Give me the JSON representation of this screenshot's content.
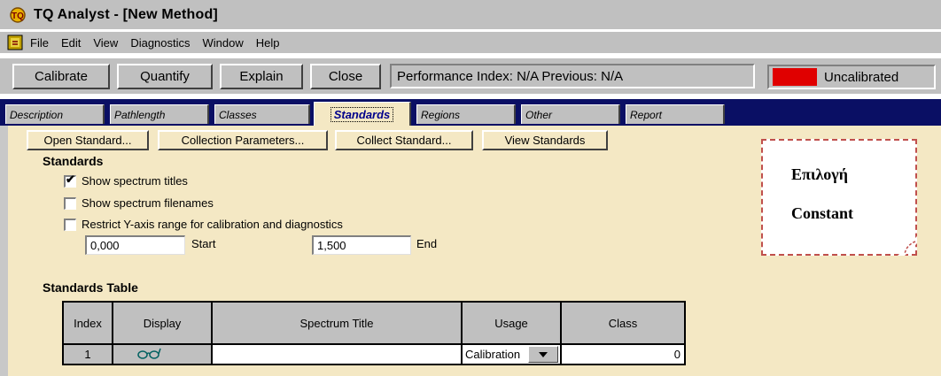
{
  "window": {
    "title": "TQ Analyst - [New Method]",
    "app_icon": "tq-app-icon"
  },
  "menu": [
    "File",
    "Edit",
    "View",
    "Diagnostics",
    "Window",
    "Help"
  ],
  "toolbar": {
    "calibrate": "Calibrate",
    "quantify": "Quantify",
    "explain": "Explain",
    "close": "Close",
    "performance_text": "Performance Index:  N/A  Previous:  N/A",
    "status_text": "Uncalibrated",
    "status_color": "#e00000"
  },
  "tabs": [
    "Description",
    "Pathlength",
    "Classes",
    "Standards",
    "Regions",
    "Other",
    "Report"
  ],
  "active_tab": "Standards",
  "standard_buttons": {
    "open": "Open Standard...",
    "collection": "Collection Parameters...",
    "collect": "Collect Standard...",
    "view": "View Standards"
  },
  "standards": {
    "heading": "Standards",
    "show_titles": {
      "label": "Show spectrum titles",
      "checked": true
    },
    "show_filenames": {
      "label": "Show spectrum filenames",
      "checked": false
    },
    "restrict_y": {
      "label": "Restrict Y-axis range for calibration and diagnostics",
      "checked": false
    },
    "start_value": "0,000",
    "start_label": "Start",
    "end_value": "1,500",
    "end_label": "End"
  },
  "table": {
    "heading": "Standards Table",
    "columns": [
      "Index",
      "Display",
      "Spectrum Title",
      "Usage",
      "Class"
    ],
    "rows": [
      {
        "index": "1",
        "display_icon": "glasses-icon",
        "title": "",
        "usage": "Calibration",
        "class": "0"
      }
    ]
  },
  "annotation": {
    "line1": "Επιλογή",
    "line2": "Constant",
    "border_color": "#c0504d"
  }
}
